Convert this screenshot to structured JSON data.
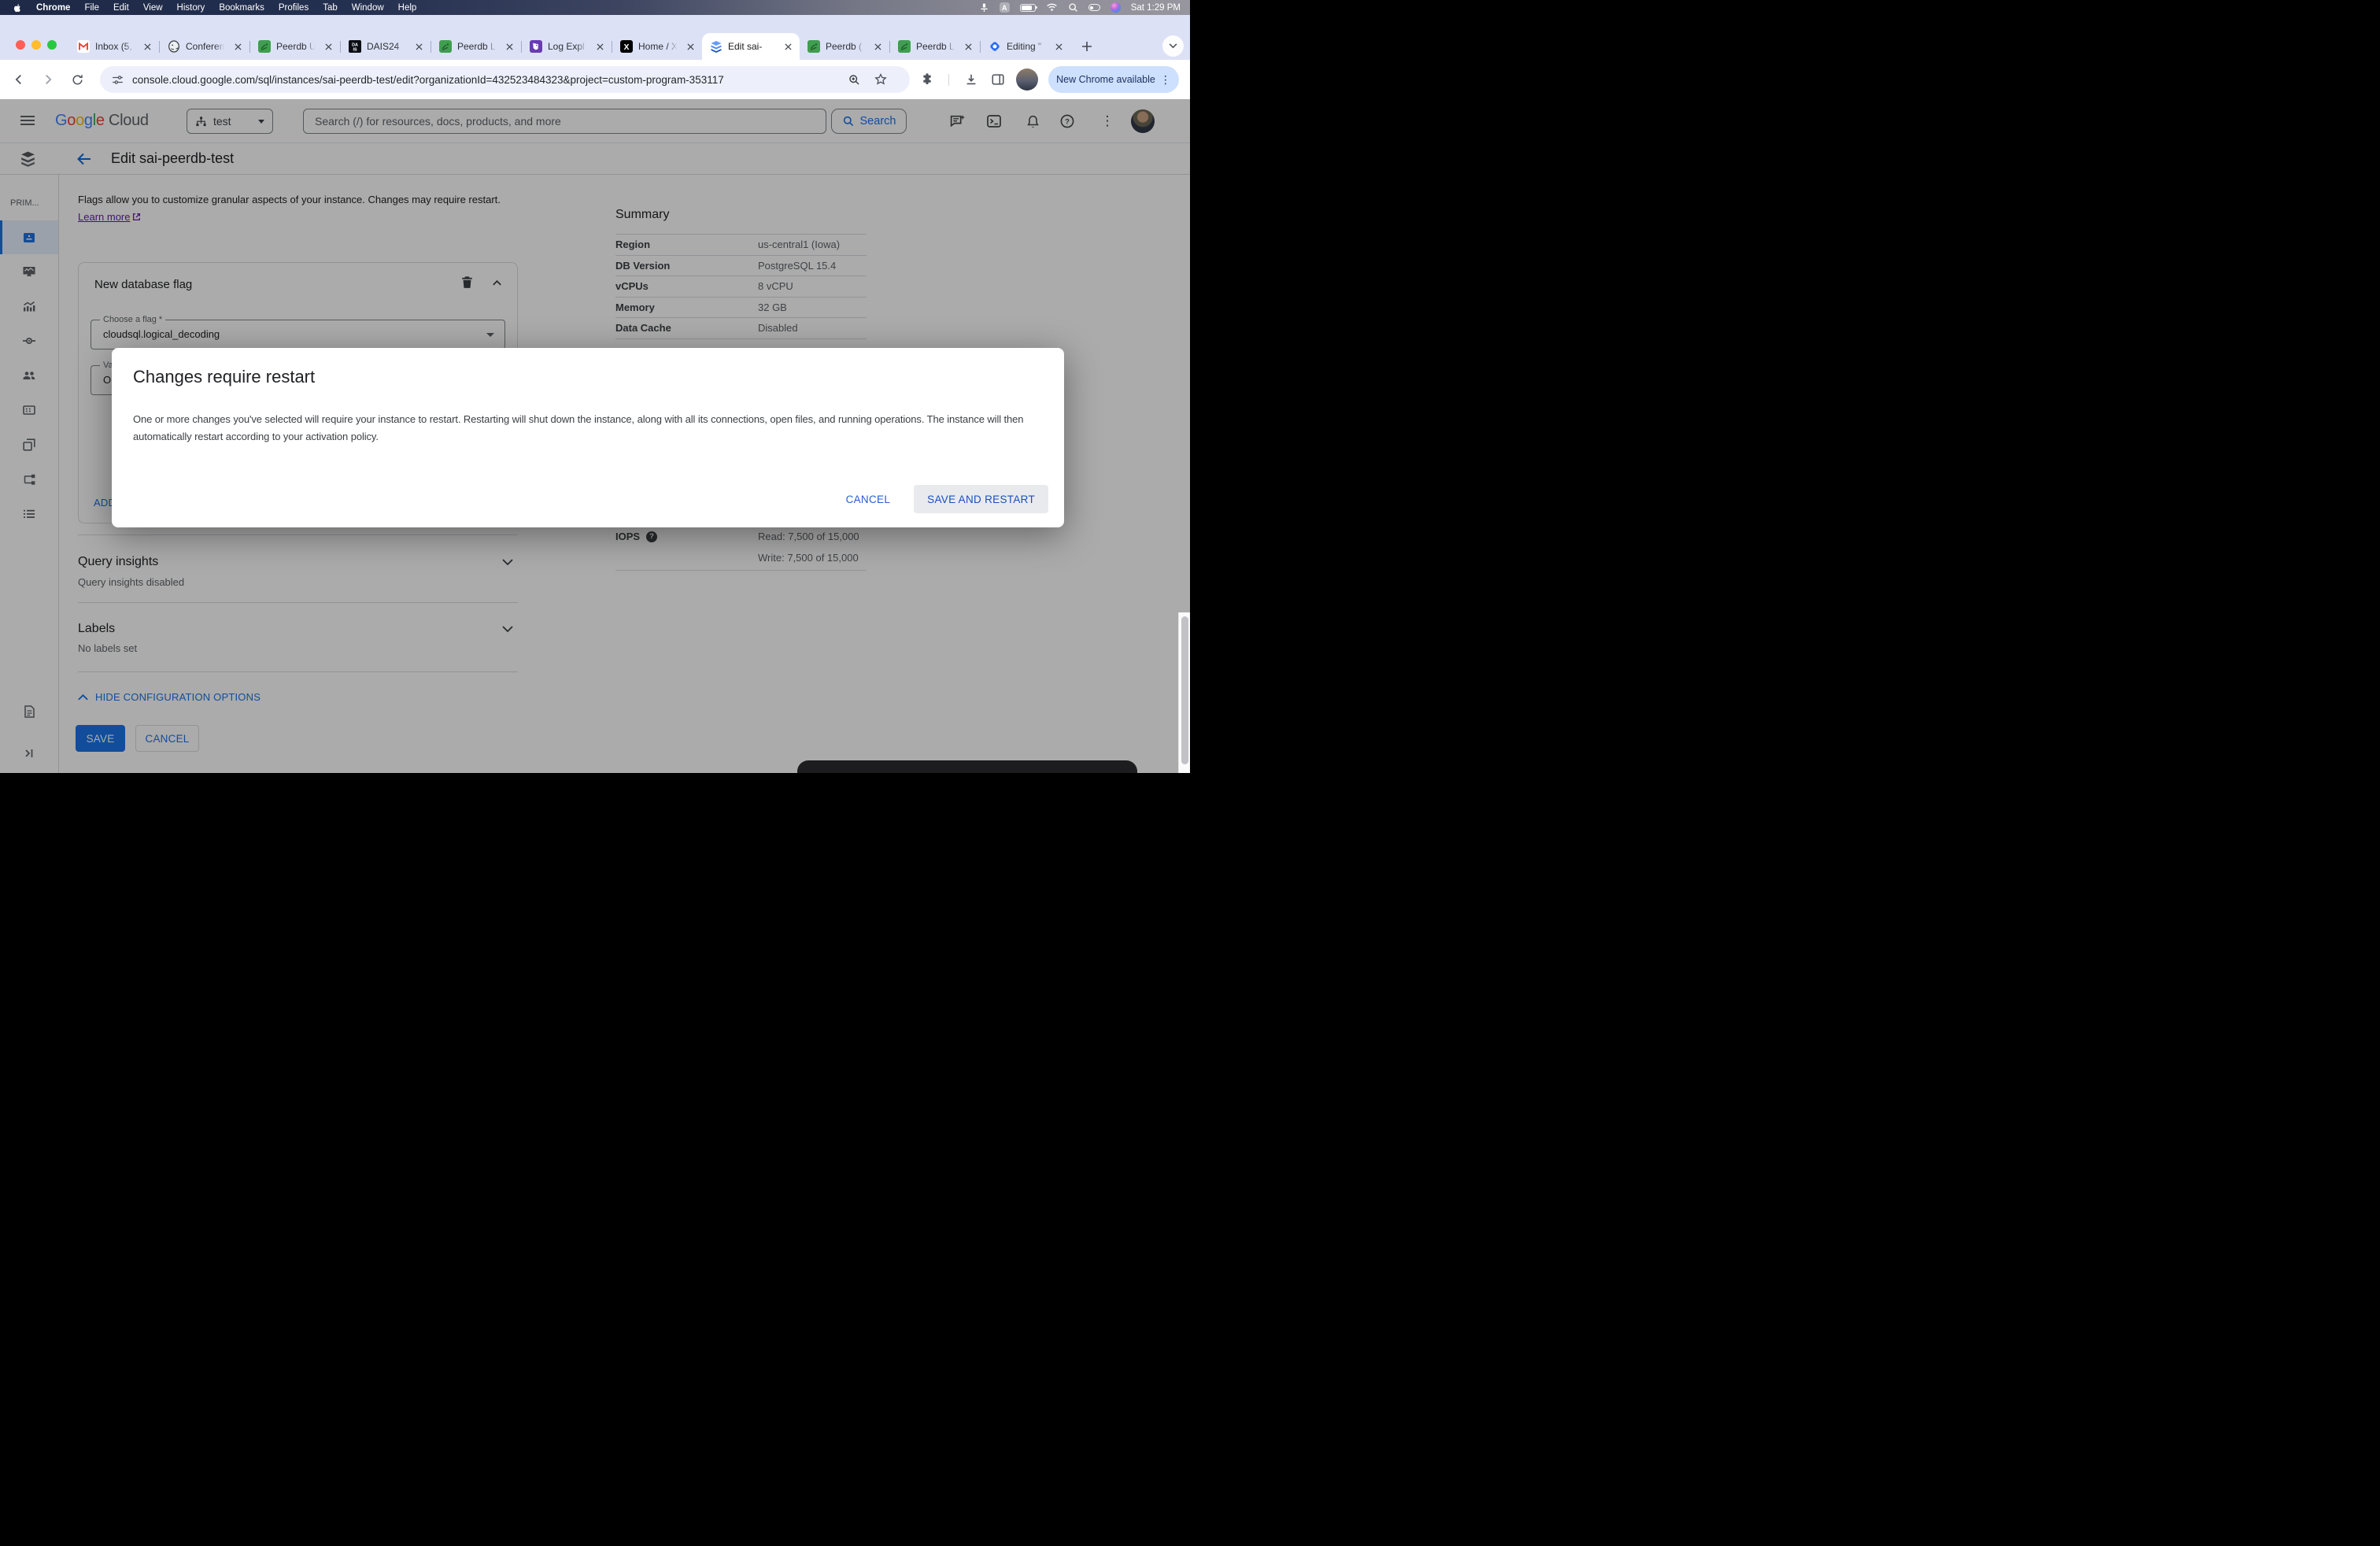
{
  "menubar": {
    "items": [
      "Chrome",
      "File",
      "Edit",
      "View",
      "History",
      "Bookmarks",
      "Profiles",
      "Tab",
      "Window",
      "Help"
    ],
    "clock": "Sat 1:29 PM"
  },
  "tabs": [
    {
      "icon": "gmail",
      "title": "Inbox (5,"
    },
    {
      "icon": "postgres",
      "title": "Conferen"
    },
    {
      "icon": "peerdb",
      "title": "Peerdb U"
    },
    {
      "icon": "dais",
      "title": "DAIS24"
    },
    {
      "icon": "peerdb",
      "title": "Peerdb L"
    },
    {
      "icon": "datadog",
      "title": "Log Expl"
    },
    {
      "icon": "x",
      "title": "Home / X"
    },
    {
      "icon": "cloudsql",
      "title": "Edit sai-",
      "active": true
    },
    {
      "icon": "peerdb",
      "title": "Peerdb ("
    },
    {
      "icon": "peerdb",
      "title": "Peerdb L"
    },
    {
      "icon": "editing",
      "title": "Editing \""
    }
  ],
  "toolbar": {
    "url": "console.cloud.google.com/sql/instances/sai-peerdb-test/edit?organizationId=432523484323&project=custom-program-353117",
    "update_label": "New Chrome available"
  },
  "gcp_header": {
    "brand_google": "Google",
    "brand_cloud": "Cloud",
    "project": "test",
    "search_placeholder": "Search (/) for resources, docs, products, and more",
    "search_button": "Search"
  },
  "title_bar": {
    "title": "Edit sai-peerdb-test"
  },
  "sidebar": {
    "section": "PRIM..."
  },
  "content": {
    "intro": "Flags allow you to customize granular aspects of your instance. Changes may require restart.",
    "learn_more": "Learn more",
    "flag_card": {
      "title": "New database flag",
      "flag_label": "Choose a flag *",
      "flag_value": "cloudsql.logical_decoding",
      "value_label": "Value *",
      "value_value": "On",
      "add_button": "ADD FLAG"
    },
    "query_insights": {
      "title": "Query insights",
      "subtitle": "Query insights disabled"
    },
    "labels": {
      "title": "Labels",
      "subtitle": "No labels set"
    },
    "hide_options": "HIDE CONFIGURATION OPTIONS",
    "save": "SAVE",
    "cancel": "CANCEL"
  },
  "summary": {
    "title": "Summary",
    "rows": [
      {
        "label": "Region",
        "value": "us-central1 (Iowa)"
      },
      {
        "label": "DB Version",
        "value": "PostgreSQL 15.4"
      },
      {
        "label": "vCPUs",
        "value": "8 vCPU"
      },
      {
        "label": "Memory",
        "value": "32 GB"
      },
      {
        "label": "Data Cache",
        "value": "Disabled"
      }
    ],
    "iops": {
      "label": "IOPS",
      "read": "Read: 7,500 of 15,000",
      "write": "Write: 7,500 of 15,000"
    }
  },
  "modal": {
    "title": "Changes require restart",
    "body": "One or more changes you've selected will require your instance to restart. Restarting will shut down the instance, along with all its connections, open files, and running operations. The instance will then automatically restart according to your activation policy.",
    "cancel_label": "CANCEL",
    "confirm_label": "SAVE AND RESTART"
  },
  "colors": {
    "accent_blue": "#1a73e8",
    "link_purple": "#681da8",
    "scrim": "rgba(0,0,0,0.33)",
    "tabstrip": "#dce1f5"
  }
}
